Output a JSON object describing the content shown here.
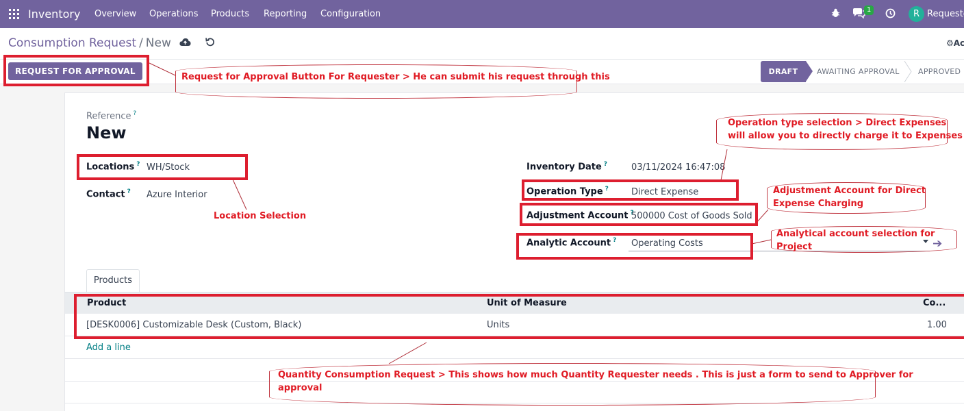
{
  "navbar": {
    "app_name": "Inventory",
    "menu": [
      "Overview",
      "Operations",
      "Products",
      "Reporting",
      "Configuration"
    ],
    "chat_badge": "1",
    "avatar_letter": "R",
    "user_name": "Requeste"
  },
  "control_panel": {
    "breadcrumb_parent": "Consumption Request",
    "breadcrumb_sep": "/",
    "breadcrumb_current": "New",
    "action_label": "Ac"
  },
  "statusbar": {
    "request_button": "REQUEST FOR APPROVAL",
    "stages": [
      "DRAFT",
      "AWAITING APPROVAL",
      "APPROVED"
    ],
    "active_stage": "DRAFT"
  },
  "form": {
    "reference_label": "Reference",
    "reference_value": "New",
    "help_mark": "?",
    "locations_label": "Locations",
    "locations_value": "WH/Stock",
    "contact_label": "Contact",
    "contact_value": "Azure Interior",
    "inventory_date_label": "Inventory Date",
    "inventory_date_value": "03/11/2024 16:47:08",
    "operation_type_label": "Operation Type",
    "operation_type_value": "Direct Expense",
    "adjustment_account_label": "Adjustment Account",
    "adjustment_account_value": "500000 Cost of Goods Sold",
    "analytic_account_label": "Analytic Account",
    "analytic_account_value": "Operating Costs"
  },
  "notebook": {
    "tab_label": "Products",
    "columns": [
      "Product",
      "Unit of Measure",
      "Co..."
    ],
    "rows": [
      {
        "product": "[DESK0006] Customizable Desk (Custom, Black)",
        "uom": "Units",
        "qty": "1.00"
      }
    ],
    "add_line": "Add a line"
  },
  "annotations": {
    "request_button_note": "Request for Approval Button For Requester > He can submit his request through this",
    "operation_type_note_1": "Operation type selection > Direct Expenses",
    "operation_type_note_2": "will allow you to directly charge it to Expenses",
    "location_note": "Location Selection",
    "adjustment_note_1": "Adjustment Account for Direct",
    "adjustment_note_2": "Expense Charging",
    "analytic_note": "Analytical account selection for Project",
    "quantity_note_1": "Quantity Consumption Request > This shows how much Quantity Requester needs  . This is just a form  to send to Approver for",
    "quantity_note_2": "approval"
  },
  "colors": {
    "navbar": "#71639e",
    "annotation_red": "#e01b24",
    "link_teal": "#017e84"
  },
  "icons": [
    "apps-grid-icon",
    "cloud-save-icon",
    "discard-icon",
    "bug-icon",
    "chat-icon",
    "clock-icon",
    "gear-icon",
    "dropdown-caret-icon",
    "arrow-right-icon"
  ]
}
